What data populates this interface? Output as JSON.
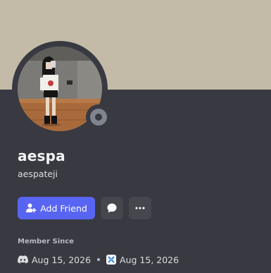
{
  "profile": {
    "display_name": "aespa",
    "username": "aespateji",
    "status": "offline"
  },
  "actions": {
    "add_friend_label": "Add Friend",
    "message_icon": "chat-bubble-icon",
    "more_icon": "ellipsis-icon"
  },
  "member_since": {
    "title": "Member Since",
    "discord_date": "Aug 15, 2026",
    "server_date": "Aug 15, 2026"
  },
  "colors": {
    "banner": "#c3bba8",
    "card": "#393941",
    "accent": "#5865f2",
    "status_offline": "#80848e"
  }
}
